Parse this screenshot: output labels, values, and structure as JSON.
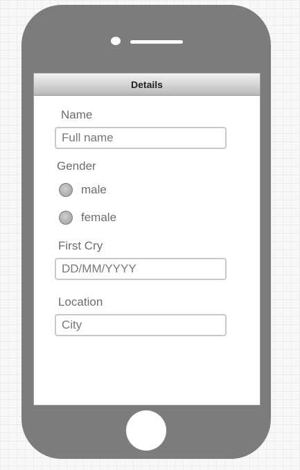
{
  "form": {
    "title": "Details",
    "name_label": "Name",
    "name_placeholder": "Full name",
    "gender_label": "Gender",
    "gender_options": [
      "male",
      "female"
    ],
    "first_cry_label": "First Cry",
    "first_cry_placeholder": "DD/MM/YYYY",
    "location_label": "Location",
    "location_placeholder": "City"
  },
  "colors": {
    "phone_body": "#7c7c7c",
    "screen": "#ffffff",
    "label_text": "#6c6c6c"
  }
}
